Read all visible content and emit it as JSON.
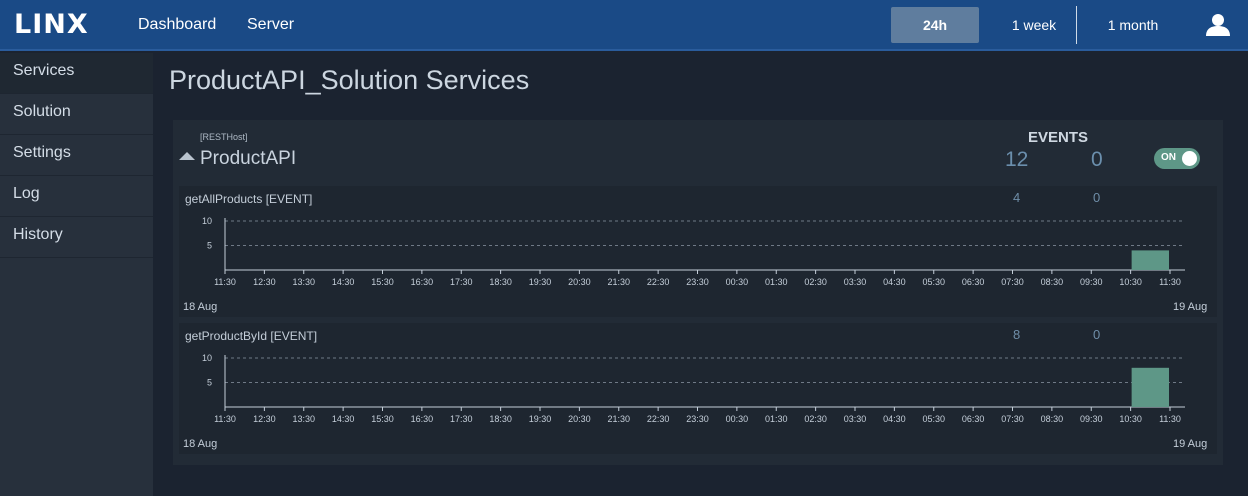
{
  "header": {
    "logo": "LINX",
    "nav": [
      "Dashboard",
      "Server"
    ],
    "ranges": [
      {
        "label": "24h",
        "active": true
      },
      {
        "label": "1 week",
        "active": false
      },
      {
        "label": "1 month",
        "active": false
      }
    ],
    "user_icon": "user-icon"
  },
  "sidebar": {
    "items": [
      {
        "label": "Services",
        "active": true
      },
      {
        "label": "Solution",
        "active": false
      },
      {
        "label": "Settings",
        "active": false
      },
      {
        "label": "Log",
        "active": false
      },
      {
        "label": "History",
        "active": false
      }
    ]
  },
  "page": {
    "title": "ProductAPI_Solution Services"
  },
  "service": {
    "host_tag": "[RESTHost]",
    "name": "ProductAPI",
    "events_label": "EVENTS",
    "count_primary": "12",
    "count_secondary": "0",
    "toggle_label": "ON",
    "toggle_on": true,
    "operations": [
      {
        "name": "getAllProducts [EVENT]",
        "count_primary": "4",
        "count_secondary": "0",
        "start_date": "18 Aug",
        "end_date": "19 Aug",
        "chart_data": {
          "type": "bar",
          "categories": [
            "11:30",
            "12:30",
            "13:30",
            "14:30",
            "15:30",
            "16:30",
            "17:30",
            "18:30",
            "19:30",
            "20:30",
            "21:30",
            "22:30",
            "23:30",
            "00:30",
            "01:30",
            "02:30",
            "03:30",
            "04:30",
            "05:30",
            "06:30",
            "07:30",
            "08:30",
            "09:30",
            "10:30",
            "11:30"
          ],
          "bars": [
            {
              "from": "10:30",
              "to": "11:30",
              "value": 4
            }
          ],
          "yticks": [
            5,
            10
          ],
          "ylim": [
            0,
            10
          ],
          "grid": true
        }
      },
      {
        "name": "getProductById [EVENT]",
        "count_primary": "8",
        "count_secondary": "0",
        "start_date": "18 Aug",
        "end_date": "19 Aug",
        "chart_data": {
          "type": "bar",
          "categories": [
            "11:30",
            "12:30",
            "13:30",
            "14:30",
            "15:30",
            "16:30",
            "17:30",
            "18:30",
            "19:30",
            "20:30",
            "21:30",
            "22:30",
            "23:30",
            "00:30",
            "01:30",
            "02:30",
            "03:30",
            "04:30",
            "05:30",
            "06:30",
            "07:30",
            "08:30",
            "09:30",
            "10:30",
            "11:30"
          ],
          "bars": [
            {
              "from": "10:30",
              "to": "11:30",
              "value": 8
            }
          ],
          "yticks": [
            5,
            10
          ],
          "ylim": [
            0,
            10
          ],
          "grid": true
        }
      }
    ]
  },
  "colors": {
    "header_bg": "#1a4a86",
    "active_range": "#5f7d9e",
    "bar": "#5e9787",
    "count": "#6b8fad"
  }
}
